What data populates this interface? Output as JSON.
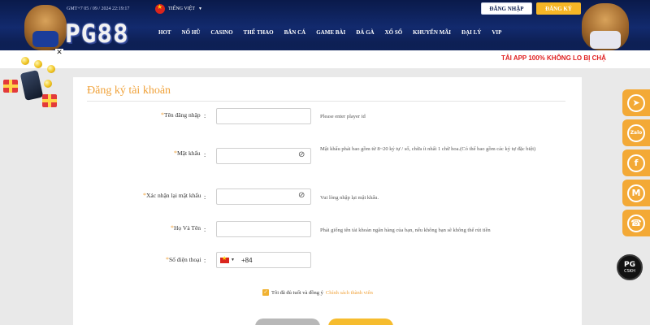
{
  "header": {
    "logo_text": "PG88",
    "datetime": "GMT+7 05 / 09 / 2024 22:19:17",
    "language": "TIẾNG VIỆT",
    "login_label": "ĐĂNG NHẬP",
    "register_label": "ĐĂNG KÝ",
    "nav": [
      "HOT",
      "NỔ HŨ",
      "CASINO",
      "THỂ THAO",
      "BẮN CÁ",
      "GAME BÀI",
      "ĐÁ GÀ",
      "XỔ SỐ",
      "KHUYẾN MÃI",
      "ĐẠI LÝ",
      "VIP"
    ]
  },
  "marquee": {
    "text": "TẢI APP 100% KHÔNG LO BỊ CHẶ"
  },
  "promo": {
    "close": "✕"
  },
  "form": {
    "title": "Đăng ký tài khoản",
    "fields": [
      {
        "label": "Tên đăng nhập",
        "value": "",
        "hint": "Please enter player id"
      },
      {
        "label": "Mật khẩu",
        "value": "",
        "hint": "Mật khẩu phải bao gồm từ 8~20 ký tự / số, chữa ít nhất 1 chữ hoa.(Có thể bao gồm các ký tự đặc biệt)"
      },
      {
        "label": "Xác nhận lại mật khẩu",
        "value": "",
        "hint": "Vui lòng nhập lại mật khẩu."
      },
      {
        "label": "Họ Và Tên",
        "value": "",
        "hint": "Phải giống tên tài khoản ngân hàng của bạn, nếu không bạn sẽ không thể rút tiền"
      },
      {
        "label": "Số điện thoại",
        "value": "",
        "hint": ""
      }
    ],
    "dial_code": "+84",
    "colon": ":",
    "required_mark": "*",
    "agree_text": "Tôi đã đủ tuổi và đồng ý",
    "agree_link": "Chính sách thành viên"
  },
  "social": [
    {
      "icon": "telegram-icon",
      "glyph": "➤"
    },
    {
      "icon": "zalo-icon",
      "glyph": "Zalo"
    },
    {
      "icon": "facebook-icon",
      "glyph": "f"
    },
    {
      "icon": "gmail-icon",
      "glyph": "M"
    },
    {
      "icon": "support-icon",
      "glyph": "☎"
    }
  ],
  "cskh": {
    "top": "PG",
    "bottom": "CSKH"
  },
  "colors": {
    "accent": "#f0a23a",
    "header_bg": "#0d2158",
    "marquee_text": "#e02020",
    "button_yellow": "#f6b626"
  }
}
